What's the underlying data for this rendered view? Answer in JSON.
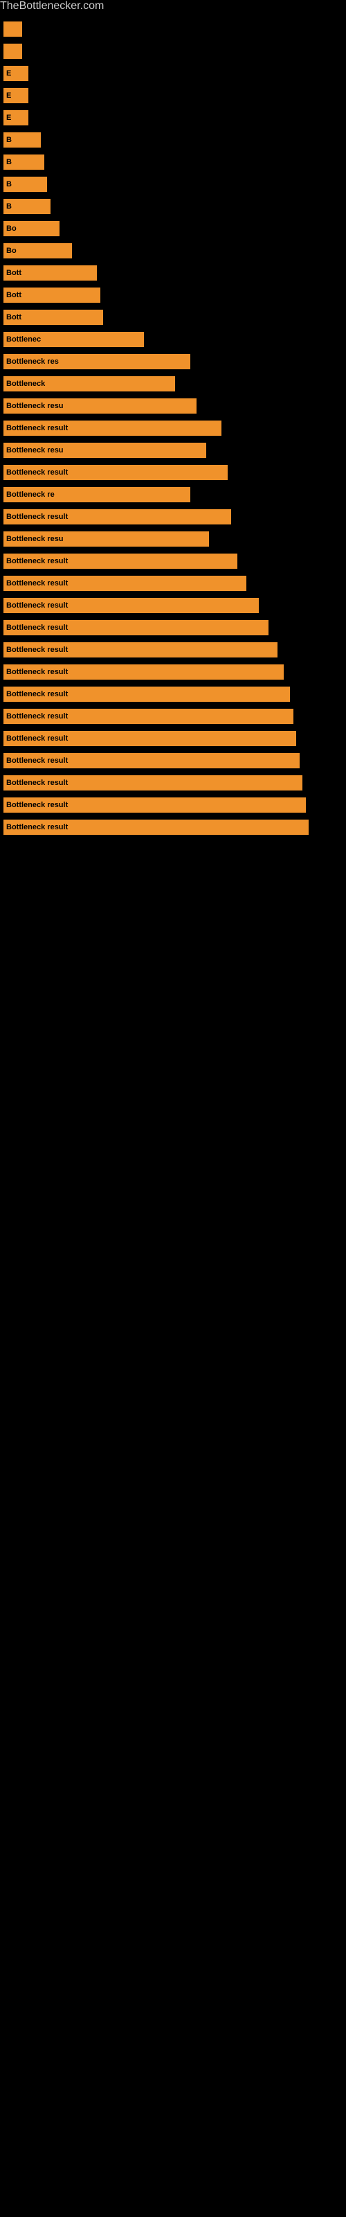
{
  "site": {
    "title": "TheBottlenecker.com"
  },
  "bars": [
    {
      "width": 6,
      "label": ""
    },
    {
      "width": 6,
      "label": ""
    },
    {
      "width": 8,
      "label": "E"
    },
    {
      "width": 8,
      "label": "E"
    },
    {
      "width": 8,
      "label": "E"
    },
    {
      "width": 12,
      "label": "B"
    },
    {
      "width": 13,
      "label": "B"
    },
    {
      "width": 14,
      "label": "B"
    },
    {
      "width": 15,
      "label": "B"
    },
    {
      "width": 18,
      "label": "Bo"
    },
    {
      "width": 22,
      "label": "Bo"
    },
    {
      "width": 30,
      "label": "Bott"
    },
    {
      "width": 31,
      "label": "Bott"
    },
    {
      "width": 32,
      "label": "Bott"
    },
    {
      "width": 45,
      "label": "Bottlenec"
    },
    {
      "width": 60,
      "label": "Bottleneck res"
    },
    {
      "width": 55,
      "label": "Bottleneck"
    },
    {
      "width": 62,
      "label": "Bottleneck resu"
    },
    {
      "width": 70,
      "label": "Bottleneck result"
    },
    {
      "width": 65,
      "label": "Bottleneck resu"
    },
    {
      "width": 72,
      "label": "Bottleneck result"
    },
    {
      "width": 60,
      "label": "Bottleneck re"
    },
    {
      "width": 73,
      "label": "Bottleneck result"
    },
    {
      "width": 66,
      "label": "Bottleneck resu"
    },
    {
      "width": 75,
      "label": "Bottleneck result"
    },
    {
      "width": 78,
      "label": "Bottleneck result"
    },
    {
      "width": 82,
      "label": "Bottleneck result"
    },
    {
      "width": 85,
      "label": "Bottleneck result"
    },
    {
      "width": 88,
      "label": "Bottleneck result"
    },
    {
      "width": 90,
      "label": "Bottleneck result"
    },
    {
      "width": 92,
      "label": "Bottleneck result"
    },
    {
      "width": 93,
      "label": "Bottleneck result"
    },
    {
      "width": 94,
      "label": "Bottleneck result"
    },
    {
      "width": 95,
      "label": "Bottleneck result"
    },
    {
      "width": 96,
      "label": "Bottleneck result"
    },
    {
      "width": 97,
      "label": "Bottleneck result"
    },
    {
      "width": 98,
      "label": "Bottleneck result"
    }
  ]
}
